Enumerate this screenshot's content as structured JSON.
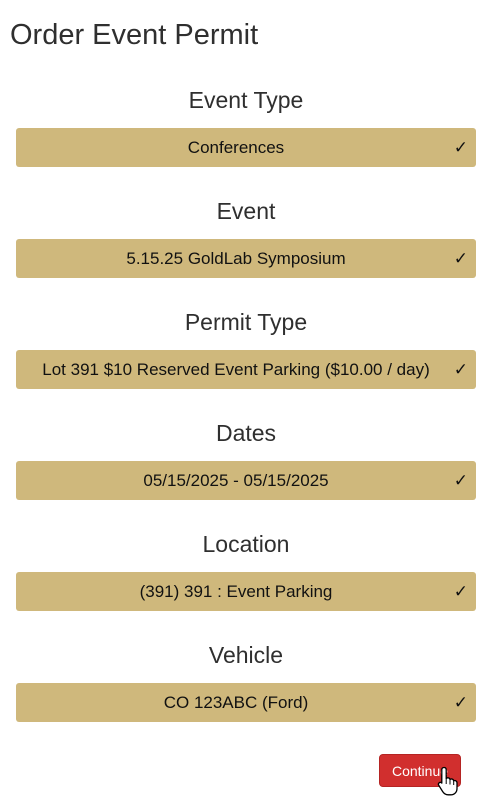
{
  "page": {
    "title": "Order Event Permit"
  },
  "sections": [
    {
      "label": "Event Type",
      "value": "Conferences",
      "status": "✓"
    },
    {
      "label": "Event",
      "value": "5.15.25 GoldLab Symposium",
      "status": "✓"
    },
    {
      "label": "Permit Type",
      "value": "Lot 391 $10 Reserved Event Parking ($10.00 / day)",
      "status": "✓"
    },
    {
      "label": "Dates",
      "value": "05/15/2025 - 05/15/2025",
      "status": "✓"
    },
    {
      "label": "Location",
      "value": "(391) 391 : Event Parking",
      "status": "✓"
    },
    {
      "label": "Vehicle",
      "value": "CO 123ABC (Ford)",
      "status": "✓"
    }
  ],
  "actions": {
    "continue_label": "Continue"
  },
  "colors": {
    "select_bg": "#cfb87c",
    "button_bg": "#d12f2e"
  },
  "icons": {
    "status": "checkmark-icon",
    "pointer": "hand-pointer-icon"
  }
}
